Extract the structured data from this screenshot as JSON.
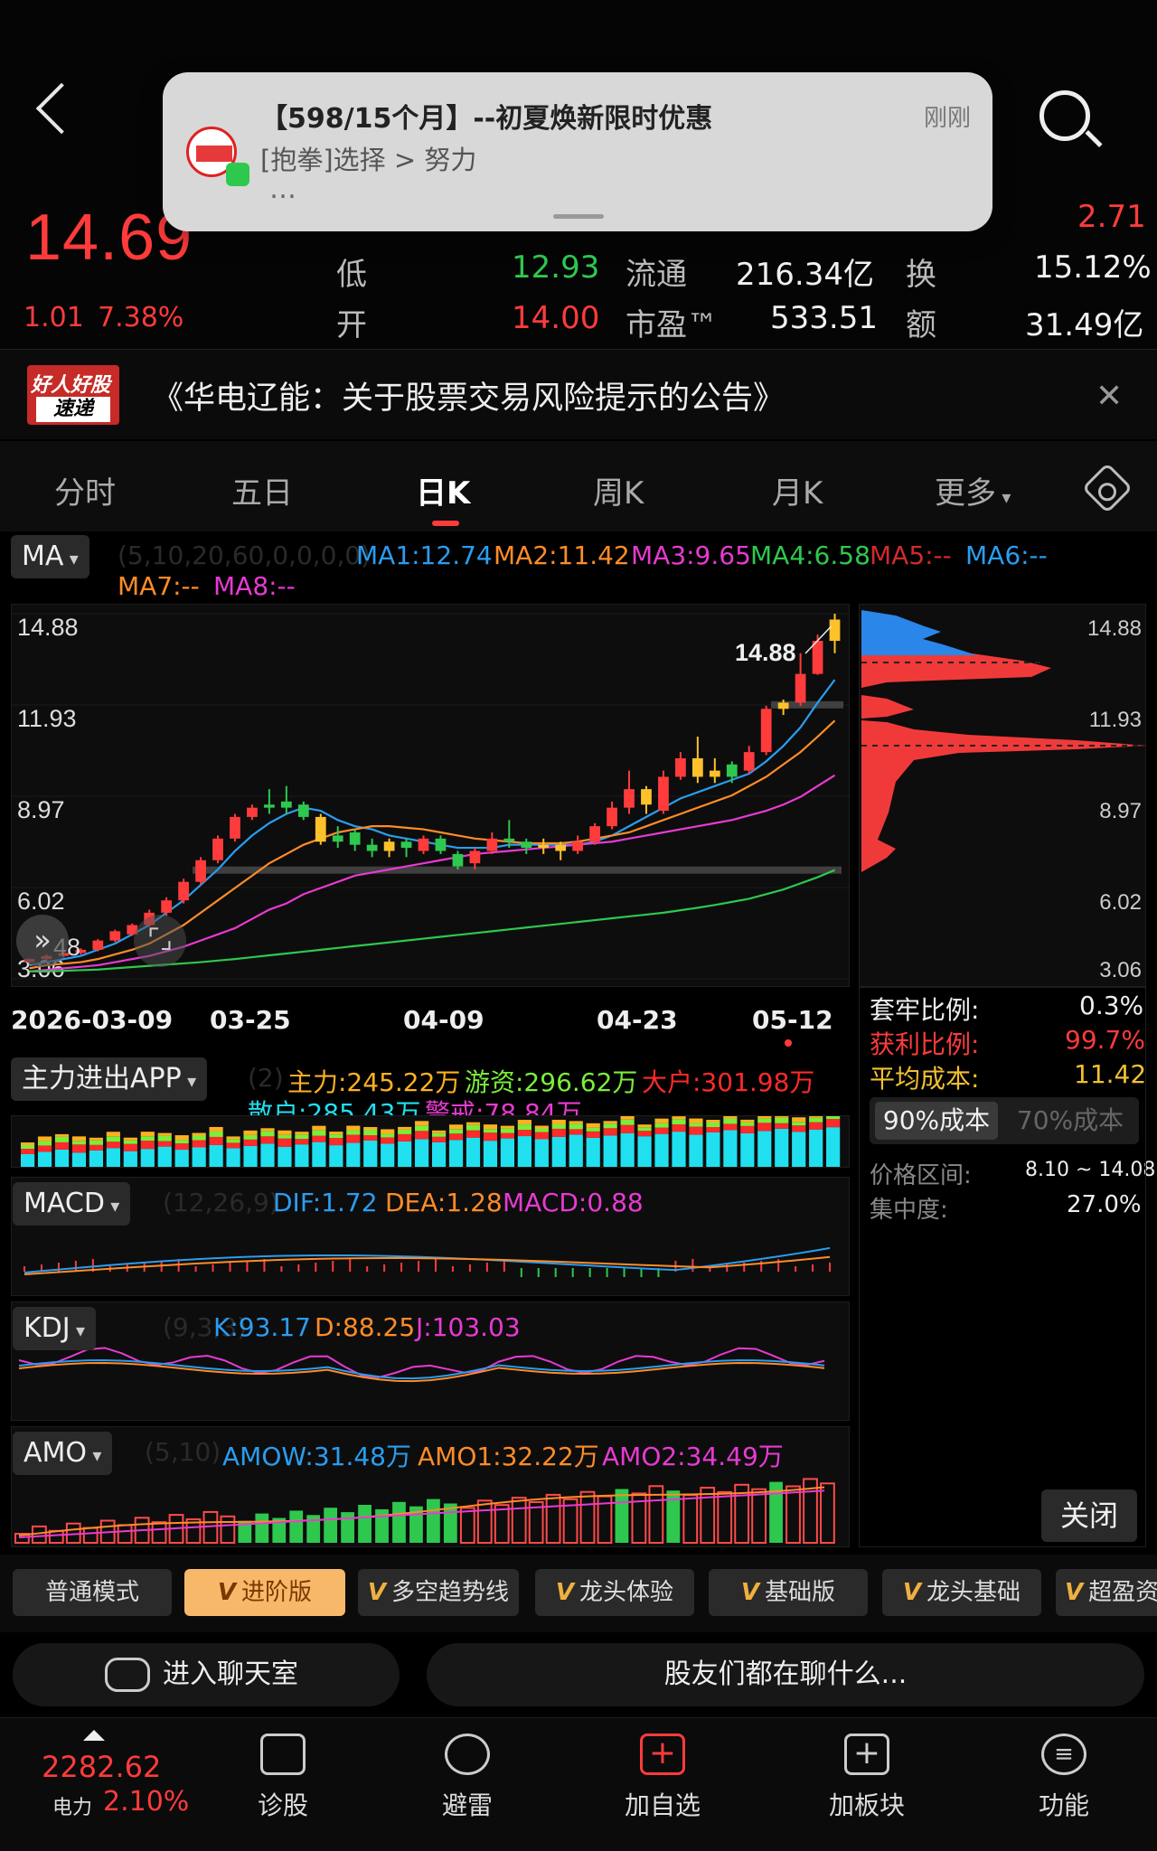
{
  "notification": {
    "title": "【598/15个月】--初夏焕新限时优惠",
    "subtitle": "[抱拳]选择 > 努力",
    "ellipsis": "…",
    "time": "刚刚"
  },
  "quote": {
    "price": "14.69",
    "change": "1.01",
    "change_pct": "7.38%",
    "high_right": "2.71",
    "low_label": "低",
    "low": "12.93",
    "open_label": "开",
    "open": "14.00",
    "float_label": "流通",
    "float": "216.34亿",
    "pe_label": "市盈™",
    "pe": "533.51",
    "turnover_label": "换",
    "turnover": "15.12%",
    "amount_label": "额",
    "amount": "31.49亿"
  },
  "banner": {
    "logo_top": "好人好股",
    "logo_bottom": "速递",
    "text": "《华电辽能：关于股票交易风险提示的公告》"
  },
  "tabs": [
    "分时",
    "五日",
    "日K",
    "周K",
    "月K",
    "更多"
  ],
  "ma": {
    "selector": "MA",
    "params": "(5,10,20,60,0,0,0,0)",
    "ma1": "MA1:12.74",
    "ma2": "MA2:11.42",
    "ma3": "MA3:9.65",
    "ma4": "MA4:6.58",
    "ma5": "MA5:--",
    "ma6": "MA6:--",
    "ma7": "MA7:--",
    "ma8": "MA8:--"
  },
  "chart_data": {
    "type": "candlestick",
    "y_ticks": [
      "14.88",
      "11.93",
      "8.97",
      "6.02",
      "3.06"
    ],
    "x_labels": [
      "2026-03-09",
      "03-25",
      "04-09",
      "04-23",
      "05-12"
    ],
    "max_label": "14.88",
    "left_label": "48",
    "ylim": [
      3.06,
      14.88
    ],
    "candles": [
      [
        3.6,
        3.7,
        3.55,
        3.72,
        "r"
      ],
      [
        3.7,
        3.8,
        3.65,
        3.85,
        "r"
      ],
      [
        3.8,
        3.9,
        3.75,
        3.95,
        "r"
      ],
      [
        3.9,
        4.0,
        3.85,
        4.05,
        "r"
      ],
      [
        4.0,
        4.3,
        3.95,
        4.35,
        "r"
      ],
      [
        4.3,
        4.6,
        4.25,
        4.65,
        "r"
      ],
      [
        4.5,
        4.8,
        4.45,
        4.85,
        "r"
      ],
      [
        4.8,
        5.2,
        4.75,
        5.3,
        "r"
      ],
      [
        5.2,
        5.6,
        5.1,
        5.7,
        "r"
      ],
      [
        5.6,
        6.2,
        5.5,
        6.3,
        "r"
      ],
      [
        6.2,
        6.9,
        6.1,
        7.0,
        "r"
      ],
      [
        6.9,
        7.6,
        6.8,
        7.7,
        "r"
      ],
      [
        7.6,
        8.3,
        7.5,
        8.4,
        "r"
      ],
      [
        8.3,
        8.6,
        8.2,
        8.7,
        "r"
      ],
      [
        8.7,
        8.6,
        8.4,
        9.2,
        "g"
      ],
      [
        8.6,
        8.8,
        8.4,
        9.3,
        "g"
      ],
      [
        8.7,
        8.3,
        8.2,
        8.8,
        "g"
      ],
      [
        8.3,
        7.5,
        7.4,
        8.4,
        "d"
      ],
      [
        7.5,
        7.7,
        7.3,
        8.0,
        "g"
      ],
      [
        7.8,
        7.4,
        7.2,
        7.9,
        "g"
      ],
      [
        7.4,
        7.2,
        7.0,
        7.6,
        "g"
      ],
      [
        7.2,
        7.5,
        7.0,
        7.6,
        "d"
      ],
      [
        7.5,
        7.3,
        7.0,
        7.6,
        "g"
      ],
      [
        7.2,
        7.6,
        7.1,
        7.7,
        "r"
      ],
      [
        7.6,
        7.2,
        7.1,
        7.7,
        "g"
      ],
      [
        7.1,
        6.7,
        6.6,
        7.2,
        "g"
      ],
      [
        6.8,
        7.2,
        6.6,
        7.3,
        "r"
      ],
      [
        7.2,
        7.6,
        7.1,
        7.8,
        "r"
      ],
      [
        7.6,
        7.6,
        7.3,
        8.2,
        "g"
      ],
      [
        7.5,
        7.3,
        7.1,
        7.6,
        "g"
      ],
      [
        7.3,
        7.4,
        7.1,
        7.6,
        "d"
      ],
      [
        7.4,
        7.2,
        6.9,
        7.5,
        "d"
      ],
      [
        7.2,
        7.5,
        7.1,
        7.7,
        "r"
      ],
      [
        7.5,
        8.0,
        7.4,
        8.1,
        "r"
      ],
      [
        8.0,
        8.6,
        7.9,
        8.8,
        "r"
      ],
      [
        8.6,
        9.2,
        8.4,
        9.8,
        "r"
      ],
      [
        9.2,
        8.7,
        8.4,
        9.3,
        "d"
      ],
      [
        8.5,
        9.6,
        8.4,
        9.8,
        "r"
      ],
      [
        9.6,
        10.2,
        9.5,
        10.4,
        "r"
      ],
      [
        10.2,
        9.6,
        9.4,
        10.9,
        "d"
      ],
      [
        9.8,
        9.6,
        9.4,
        10.2,
        "d"
      ],
      [
        9.6,
        10.0,
        9.4,
        10.1,
        "g"
      ],
      [
        9.8,
        10.4,
        9.7,
        10.6,
        "r"
      ],
      [
        10.4,
        11.8,
        10.3,
        11.9,
        "r"
      ],
      [
        11.8,
        12.0,
        11.6,
        12.1,
        "d"
      ],
      [
        12.0,
        12.93,
        11.9,
        13.6,
        "r"
      ],
      [
        12.93,
        14.0,
        12.9,
        14.2,
        "r"
      ],
      [
        14.0,
        14.69,
        13.6,
        14.88,
        "d"
      ]
    ],
    "ma_lines": {
      "ma1": [
        3.5,
        3.6,
        3.7,
        3.8,
        4.0,
        4.2,
        4.5,
        4.8,
        5.2,
        5.6,
        6.1,
        6.6,
        7.2,
        7.7,
        8.1,
        8.4,
        8.6,
        8.5,
        8.2,
        8.0,
        7.9,
        7.7,
        7.6,
        7.5,
        7.4,
        7.3,
        7.3,
        7.3,
        7.4,
        7.4,
        7.4,
        7.4,
        7.4,
        7.5,
        7.7,
        8.0,
        8.3,
        8.6,
        8.9,
        9.1,
        9.3,
        9.5,
        9.7,
        10.1,
        10.6,
        11.2,
        12.0,
        12.74
      ],
      "ma2": [
        3.4,
        3.5,
        3.55,
        3.6,
        3.7,
        3.85,
        4.0,
        4.2,
        4.5,
        4.8,
        5.2,
        5.6,
        6.0,
        6.4,
        6.8,
        7.1,
        7.4,
        7.6,
        7.8,
        7.9,
        8.0,
        8.0,
        7.95,
        7.9,
        7.8,
        7.7,
        7.6,
        7.55,
        7.5,
        7.45,
        7.45,
        7.45,
        7.5,
        7.6,
        7.7,
        7.8,
        8.0,
        8.2,
        8.4,
        8.6,
        8.8,
        9.0,
        9.3,
        9.6,
        10.0,
        10.4,
        10.9,
        11.42
      ],
      "ma3": [
        3.3,
        3.35,
        3.4,
        3.45,
        3.5,
        3.6,
        3.7,
        3.8,
        3.95,
        4.1,
        4.3,
        4.5,
        4.7,
        5.0,
        5.3,
        5.5,
        5.8,
        6.0,
        6.2,
        6.4,
        6.5,
        6.6,
        6.7,
        6.8,
        6.9,
        7.0,
        7.1,
        7.15,
        7.2,
        7.25,
        7.3,
        7.35,
        7.4,
        7.45,
        7.5,
        7.6,
        7.7,
        7.8,
        7.9,
        8.0,
        8.1,
        8.2,
        8.35,
        8.5,
        8.7,
        8.95,
        9.3,
        9.65
      ],
      "ma4": [
        3.3,
        3.3,
        3.32,
        3.34,
        3.36,
        3.4,
        3.44,
        3.48,
        3.52,
        3.56,
        3.6,
        3.65,
        3.7,
        3.76,
        3.82,
        3.88,
        3.94,
        4.0,
        4.06,
        4.12,
        4.18,
        4.24,
        4.3,
        4.36,
        4.42,
        4.48,
        4.54,
        4.6,
        4.66,
        4.72,
        4.78,
        4.84,
        4.9,
        4.96,
        5.02,
        5.08,
        5.14,
        5.2,
        5.28,
        5.36,
        5.45,
        5.55,
        5.65,
        5.8,
        5.95,
        6.15,
        6.35,
        6.58
      ]
    },
    "support_lines": [
      6.58,
      12.93
    ]
  },
  "chips": {
    "trapped_label": "套牢比例:",
    "trapped": "0.3%",
    "profit_label": "获利比例:",
    "profit": "99.7%",
    "avg_label": "平均成本:",
    "avg": "11.42",
    "seg_on": "90%成本",
    "seg_off": "70%成本",
    "range_label": "价格区间:",
    "range": "8.10 ~ 14.08",
    "conc_label": "集中度:",
    "conc": "27.0%",
    "close": "关闭"
  },
  "fund": {
    "selector": "主力进出APP",
    "params": "(2)",
    "main": "主力:245.22万",
    "hot": "游资:296.62万",
    "big": "大户:301.98万",
    "retail": "散户:285.43万",
    "warn": "警戒:78.84万"
  },
  "macd": {
    "selector": "MACD",
    "params": "(12,26,9)",
    "dif": "DIF:1.72",
    "dea": "DEA:1.28",
    "macd": "MACD:0.88"
  },
  "kdj": {
    "selector": "KDJ",
    "params": "(9,3,3)",
    "k": "K:93.17",
    "d": "D:88.25",
    "j": "J:103.03"
  },
  "amo": {
    "selector": "AMO",
    "params": "(5,10)",
    "amow": "AMOW:31.48万",
    "amo1": "AMO1:32.22万",
    "amo2": "AMO2:34.49万"
  },
  "modes": [
    "普通模式",
    "进阶版",
    "多空趋势线",
    "龙头体验",
    "基础版",
    "龙头基础",
    "超盈资"
  ],
  "chat": {
    "enter": "进入聊天室",
    "talk": "股友们都在聊什么..."
  },
  "bottom": {
    "index_value": "2282.62",
    "index_name": "电力",
    "index_pct": "2.10%",
    "nav": [
      "诊股",
      "避雷",
      "加自选",
      "加板块",
      "功能"
    ]
  }
}
